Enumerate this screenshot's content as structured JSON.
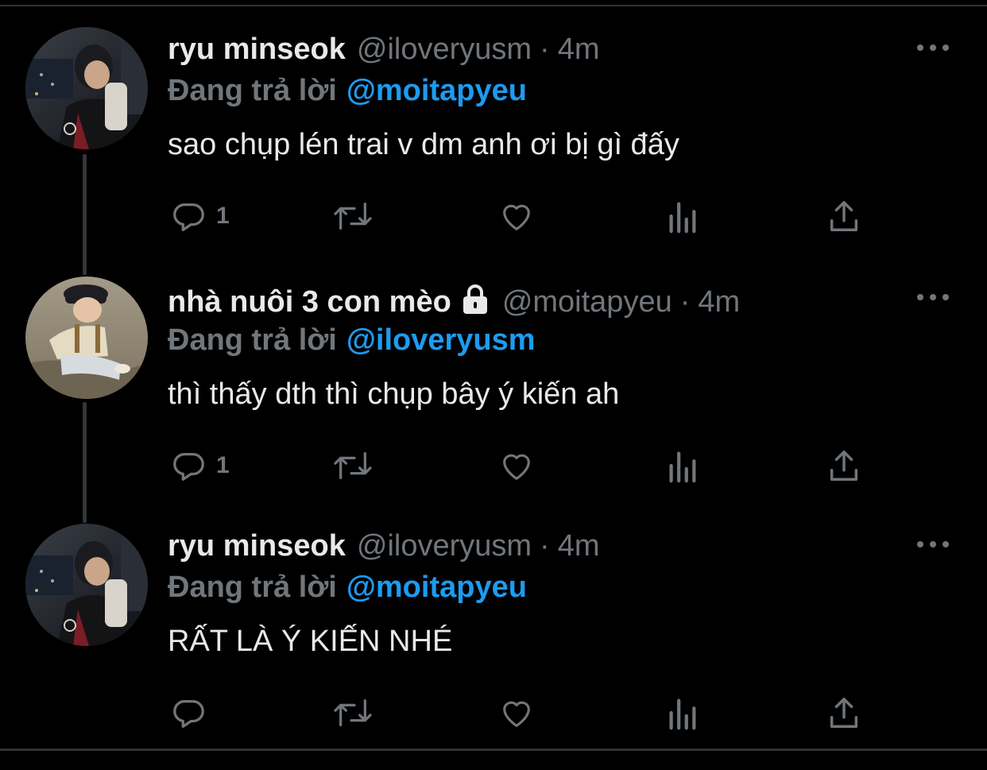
{
  "colors": {
    "background": "#000000",
    "text": "#e7e9ea",
    "secondary": "#71767b",
    "mention": "#1d9bf0",
    "divider": "#2f3336"
  },
  "tweets": [
    {
      "display_name": "ryu minseok",
      "handle": "@iloveryusm",
      "separator": "·",
      "time": "4m",
      "reply_prefix": "Đang trả lời",
      "reply_to": "@moitapyeu",
      "text": "sao chụp lén trai v dm anh ơi bị gì đấy",
      "reply_count": "1",
      "avatar_icon": "profile-photo",
      "locked": false
    },
    {
      "display_name": "nhà nuôi 3 con mèo",
      "handle": "@moitapyeu",
      "separator": "·",
      "time": "4m",
      "reply_prefix": "Đang trả lời",
      "reply_to": "@iloveryusm",
      "text": "thì thấy dth thì chụp bây ý kiến ah",
      "reply_count": "1",
      "avatar_icon": "profile-photo",
      "locked": true,
      "lock_icon": "lock-icon"
    },
    {
      "display_name": "ryu minseok",
      "handle": "@iloveryusm",
      "separator": "·",
      "time": "4m",
      "reply_prefix": "Đang trả lời",
      "reply_to": "@moitapyeu",
      "text": "RẤT LÀ Ý KIẾN NHÉ",
      "reply_count": "",
      "avatar_icon": "profile-photo",
      "locked": false
    }
  ],
  "action_icons": [
    "reply-icon",
    "retweet-icon",
    "like-icon",
    "views-icon",
    "share-icon"
  ],
  "more_icon": "more-options-icon"
}
